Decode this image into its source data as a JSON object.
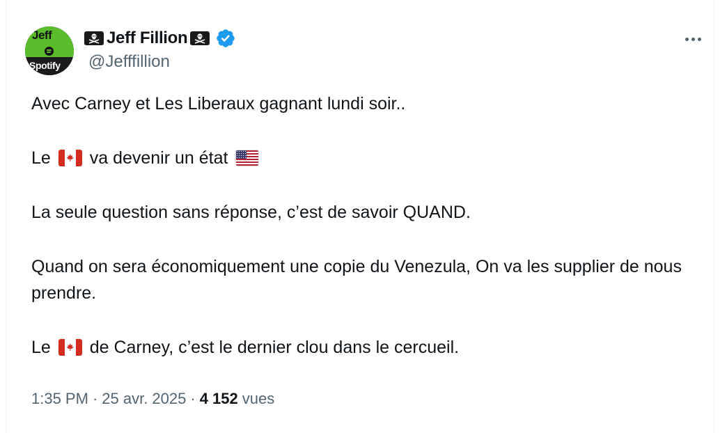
{
  "author": {
    "display_name": "Jeff Fillion",
    "handle": "@Jefffillion",
    "verified": true,
    "avatar_text_top": "Jeff",
    "avatar_text_bottom": "Spotify"
  },
  "tweet": {
    "line1": "Avec Carney et Les Liberaux gagnant lundi soir..",
    "line2_before": "Le",
    "line2_after": "va devenir un état",
    "line3": "La seule question sans réponse, c’est de savoir QUAND.",
    "line4": "Quand on sera économiquement une copie du Venezula, On va les supplier de nous prendre.",
    "line5_before": "Le",
    "line5_after": "de Carney, c’est le dernier clou dans le cercueil."
  },
  "meta": {
    "time": "1:35 PM",
    "separator": "·",
    "date": "25 avr. 2025",
    "views_count": "4 152",
    "views_label": "vues"
  },
  "icons": {
    "flag_canada": "canada-flag-icon",
    "flag_usa": "usa-flag-icon",
    "pirate_flag": "pirate-flag-icon",
    "verified": "verified-badge-icon",
    "more": "more-options-icon"
  },
  "colors": {
    "text_primary": "#0f1419",
    "text_secondary": "#536471",
    "verified_blue": "#1d9bf0",
    "avatar_green": "#5bbd2b"
  }
}
